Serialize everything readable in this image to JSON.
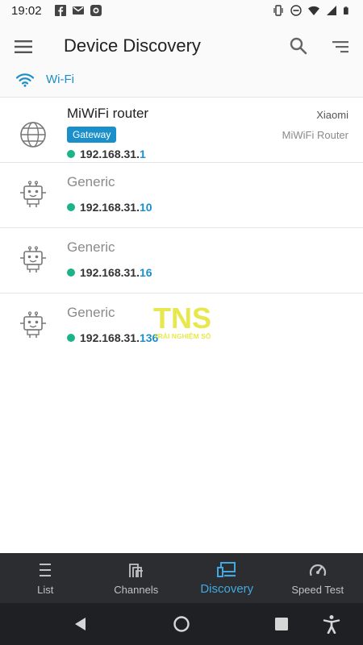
{
  "status_bar": {
    "time": "19:02",
    "left_icons": [
      "facebook-icon",
      "gmail-icon",
      "app-icon"
    ],
    "right_icons": [
      "vibrate-icon",
      "do-not-disturb-icon",
      "wifi-signal-icon",
      "cell-signal-icon",
      "battery-icon"
    ]
  },
  "toolbar": {
    "title": "Device Discovery",
    "menu_icon": "menu-icon",
    "search_icon": "search-icon",
    "sort_icon": "sort-icon"
  },
  "network": {
    "label": "Wi-Fi",
    "icon": "wifi-icon"
  },
  "devices": [
    {
      "name": "MiWiFi router",
      "badge": "Gateway",
      "vendor": "Xiaomi",
      "model": "MiWiFi Router",
      "ip_prefix": "192.168.31.",
      "ip_last": "1",
      "icon": "globe-icon",
      "online": true
    },
    {
      "name": "Generic",
      "ip_prefix": "192.168.31.",
      "ip_last": "10",
      "icon": "robot-device-icon",
      "online": true
    },
    {
      "name": "Generic",
      "ip_prefix": "192.168.31.",
      "ip_last": "16",
      "icon": "robot-device-icon",
      "online": true
    },
    {
      "name": "Generic",
      "ip_prefix": "192.168.31.",
      "ip_last": "136",
      "icon": "robot-device-icon",
      "online": true
    }
  ],
  "watermark": {
    "logo_text": "TNS",
    "tagline": "TRẢI NGHIỆM SỐ"
  },
  "bottom_nav": {
    "items": [
      {
        "label": "List",
        "icon": "list-icon",
        "active": false
      },
      {
        "label": "Channels",
        "icon": "channels-icon",
        "active": false
      },
      {
        "label": "Discovery",
        "icon": "discovery-icon",
        "active": true
      },
      {
        "label": "Speed Test",
        "icon": "speedometer-icon",
        "active": false
      }
    ]
  },
  "system_nav": {
    "items": [
      "back-icon",
      "home-icon",
      "recents-icon",
      "accessibility-icon"
    ]
  },
  "colors": {
    "accent": "#1a8fc9",
    "online": "#1db388",
    "nav_background": "#2b2d30",
    "nav_active": "#42a9e0"
  }
}
